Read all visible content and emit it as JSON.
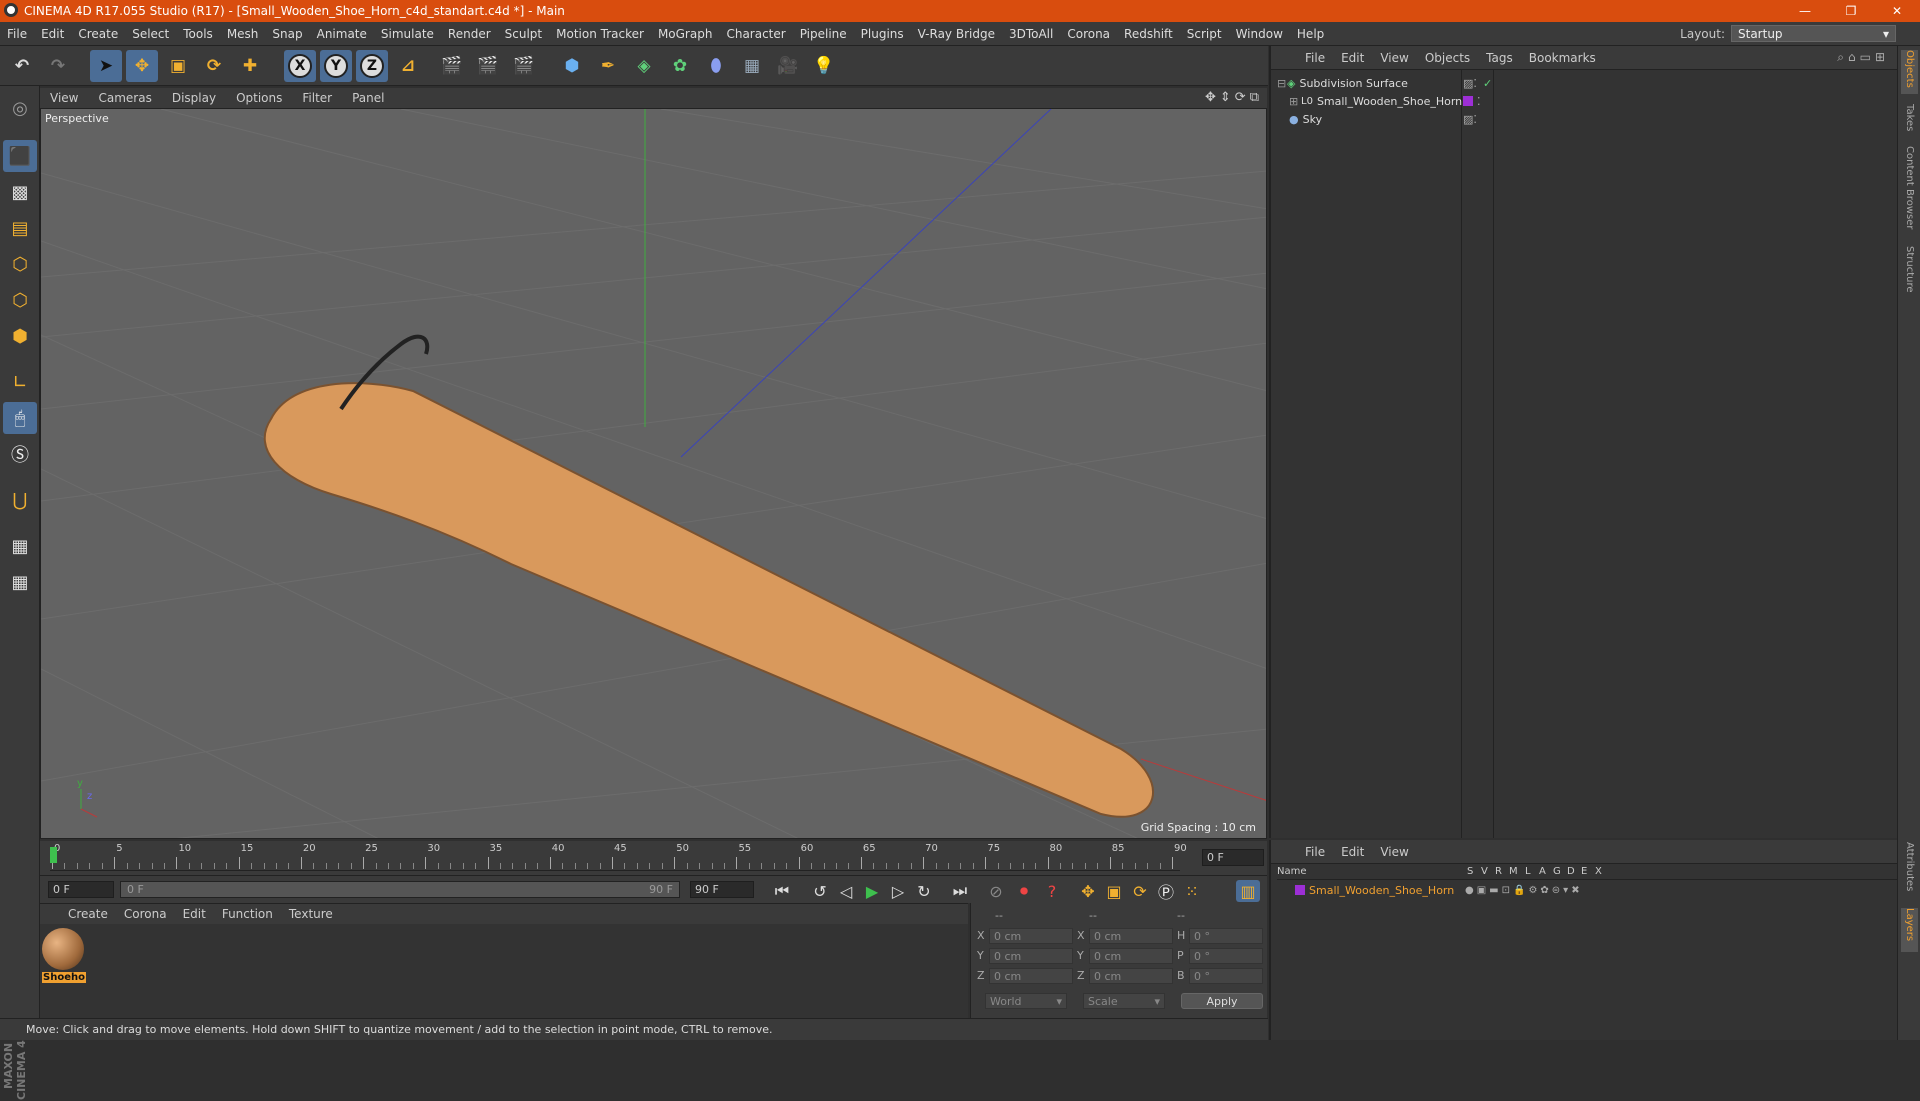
{
  "titlebar": {
    "title": "CINEMA 4D R17.055 Studio (R17) - [Small_Wooden_Shoe_Horn_c4d_standart.c4d *] - Main",
    "min": "—",
    "restore": "❐",
    "close": "✕"
  },
  "menu": [
    "File",
    "Edit",
    "Create",
    "Select",
    "Tools",
    "Mesh",
    "Snap",
    "Animate",
    "Simulate",
    "Render",
    "Sculpt",
    "Motion Tracker",
    "MoGraph",
    "Character",
    "Pipeline",
    "Plugins",
    "V-Ray Bridge",
    "3DToAll",
    "Corona",
    "Redshift",
    "Script",
    "Window",
    "Help"
  ],
  "layout": {
    "label": "Layout:",
    "value": "Startup"
  },
  "toolbar": {
    "x": "X",
    "y": "Y",
    "z": "Z"
  },
  "viewport": {
    "menu": [
      "View",
      "Cameras",
      "Display",
      "Options",
      "Filter",
      "Panel"
    ],
    "label": "Perspective",
    "grid_spacing": "Grid Spacing : 10 cm"
  },
  "timeline": {
    "ticks": [
      "0",
      "5",
      "10",
      "15",
      "20",
      "25",
      "30",
      "35",
      "40",
      "45",
      "50",
      "55",
      "60",
      "65",
      "70",
      "75",
      "80",
      "85",
      "90"
    ],
    "current": "0 F"
  },
  "playbar": {
    "start": "0 F",
    "range_start": "0 F",
    "range_end": "90 F",
    "end": "90 F"
  },
  "materials": {
    "menu": [
      "Create",
      "Corona",
      "Edit",
      "Function",
      "Texture"
    ],
    "items": [
      {
        "name": "Shoeho"
      }
    ]
  },
  "coords": {
    "header": [
      "--",
      "--",
      "--"
    ],
    "rows": [
      {
        "a": "X",
        "av": "0 cm",
        "b": "X",
        "bv": "0 cm",
        "c": "H",
        "cv": "0 °"
      },
      {
        "a": "Y",
        "av": "0 cm",
        "b": "Y",
        "bv": "0 cm",
        "c": "P",
        "cv": "0 °"
      },
      {
        "a": "Z",
        "av": "0 cm",
        "b": "Z",
        "bv": "0 cm",
        "c": "B",
        "cv": "0 °"
      }
    ],
    "world": "World",
    "scale": "Scale",
    "apply": "Apply"
  },
  "status": "Move: Click and drag to move elements. Hold down SHIFT to quantize movement / add to the selection in point mode, CTRL to remove.",
  "objects": {
    "menu": [
      "File",
      "Edit",
      "View",
      "Objects",
      "Tags",
      "Bookmarks"
    ],
    "items": [
      {
        "name": "Subdivision Surface"
      },
      {
        "name": "Small_Wooden_Shoe_Horn"
      },
      {
        "name": "Sky"
      }
    ]
  },
  "layers": {
    "menu": [
      "File",
      "Edit",
      "View"
    ],
    "col_name": "Name",
    "cols": [
      "S",
      "V",
      "R",
      "M",
      "L",
      "A",
      "G",
      "D",
      "E",
      "X"
    ],
    "row": "Small_Wooden_Shoe_Horn"
  },
  "sidetabs": [
    "Objects",
    "Takes",
    "Content Browser",
    "Structure",
    "Attributes",
    "Layers"
  ],
  "colors": {
    "title": "#d94d0e",
    "accent": "#4b6d96",
    "layer": "#9d2fd6",
    "obj_active": "#f0a030"
  }
}
